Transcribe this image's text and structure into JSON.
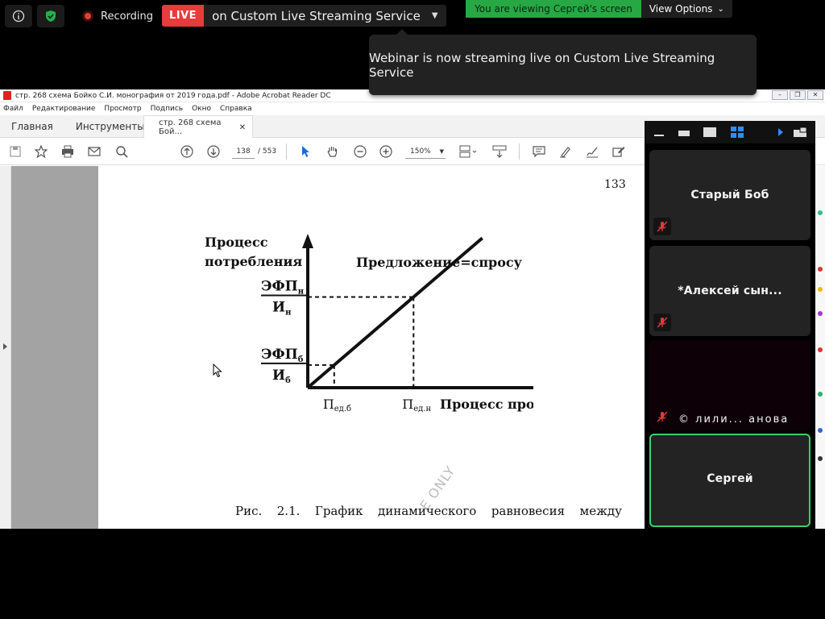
{
  "zoom_top": {
    "recording_label": "Recording",
    "live_badge": "LIVE",
    "live_text": "on Custom Live Streaming Service",
    "viewing_banner": "You are viewing Сергей's screen",
    "view_options_label": "View Options",
    "toast": "Webinar is now streaming live on Custom Live Streaming Service",
    "colors": {
      "live_red": "#e83b3b",
      "banner_green": "#27a844",
      "active_border": "#3ad06b"
    }
  },
  "acrobat": {
    "title": "стр. 268 схема Бойко С.И. монография от 2019 года.pdf - Adobe Acrobat Reader DC",
    "menu": [
      "Файл",
      "Редактирование",
      "Просмотр",
      "Подпись",
      "Окно",
      "Справка"
    ],
    "tabs": {
      "home": "Главная",
      "tools": "Инструменты",
      "doc": "стр. 268 схема Бой...",
      "close": "✕"
    },
    "page_current": "138",
    "page_total": "/ 553",
    "zoom": "150%"
  },
  "document": {
    "page_number": "133",
    "caption_words": [
      "Рис.",
      "2.1.",
      "График",
      "динамического",
      "равновесия",
      "между"
    ],
    "watermark": "E ONLY"
  },
  "chart_data": {
    "type": "line",
    "y_title": [
      "Процесс",
      "потребления"
    ],
    "x_title": "Процесс производства",
    "line_label": "Предложение=спросу",
    "x_ticks": [
      {
        "main": "П",
        "sub": "ед.б"
      },
      {
        "main": "П",
        "sub": "ед.н"
      }
    ],
    "y_ticks": [
      {
        "num_main": "ЭФП",
        "num_sub": "н",
        "den_main": "И",
        "den_sub": "н"
      },
      {
        "num_main": "ЭФП",
        "num_sub": "б",
        "den_main": "И",
        "den_sub": "б"
      }
    ],
    "points": [
      [
        0,
        0
      ],
      [
        0.15,
        0.15
      ],
      [
        0.6,
        0.6
      ],
      [
        0.99,
        0.99
      ]
    ],
    "dashed_projections": [
      [
        0.15,
        0.15
      ],
      [
        0.6,
        0.6
      ]
    ],
    "xlim": [
      0,
      1.7
    ],
    "ylim": [
      0,
      1.2
    ],
    "grid": false
  },
  "participants": [
    {
      "name": "Старый Боб",
      "muted": true,
      "active": false,
      "dark": false
    },
    {
      "name": "*Алексей сын...",
      "muted": true,
      "active": false,
      "dark": false
    },
    {
      "name": "© лили... анова",
      "muted": true,
      "active": false,
      "dark": true
    },
    {
      "name": "Сергей",
      "muted": false,
      "active": true,
      "dark": false
    }
  ]
}
